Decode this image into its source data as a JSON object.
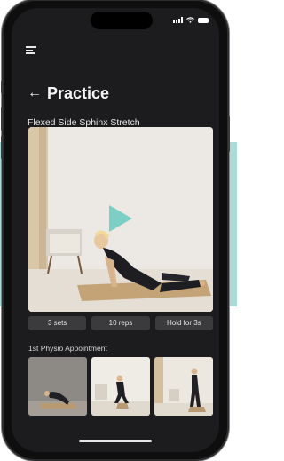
{
  "header": {
    "title": "Practice",
    "back_icon": "arrow-left-icon",
    "menu_icon": "hamburger-menu-icon"
  },
  "exercise": {
    "name": "Flexed Side Sphinx Stretch",
    "play_icon": "play-icon"
  },
  "chips": [
    {
      "label": "3 sets"
    },
    {
      "label": "10 reps"
    },
    {
      "label": "Hold for 3s"
    }
  ],
  "section": {
    "label": "1st Physio Appointment"
  },
  "colors": {
    "screen_bg": "#1c1c1e",
    "accent_teal": "#7ccfc4",
    "background_band": "#a9dcd4",
    "chip_bg": "#3b3b3d"
  }
}
